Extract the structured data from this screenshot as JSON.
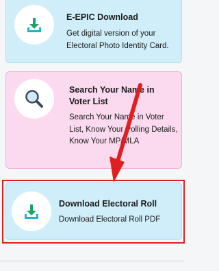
{
  "cards": [
    {
      "title": "E-EPIC Download",
      "description": "Get digital version of your Electoral Photo Identity Card.",
      "icon": "download-icon"
    },
    {
      "title": "Search Your Name in Voter List",
      "description": "Search Your Name in Voter List, Know Your Polling Details, Know Your MP/MLA",
      "icon": "magnifier-icon"
    },
    {
      "title": "Download Electoral Roll",
      "description": "Download Electoral Roll PDF",
      "icon": "download-icon"
    }
  ],
  "colors": {
    "card_blue": "#cfeefa",
    "card_pink": "#fbd9ee",
    "annotation_red": "#e02020",
    "icon_green": "#1aa36f",
    "icon_teal": "#1fb5c7"
  }
}
